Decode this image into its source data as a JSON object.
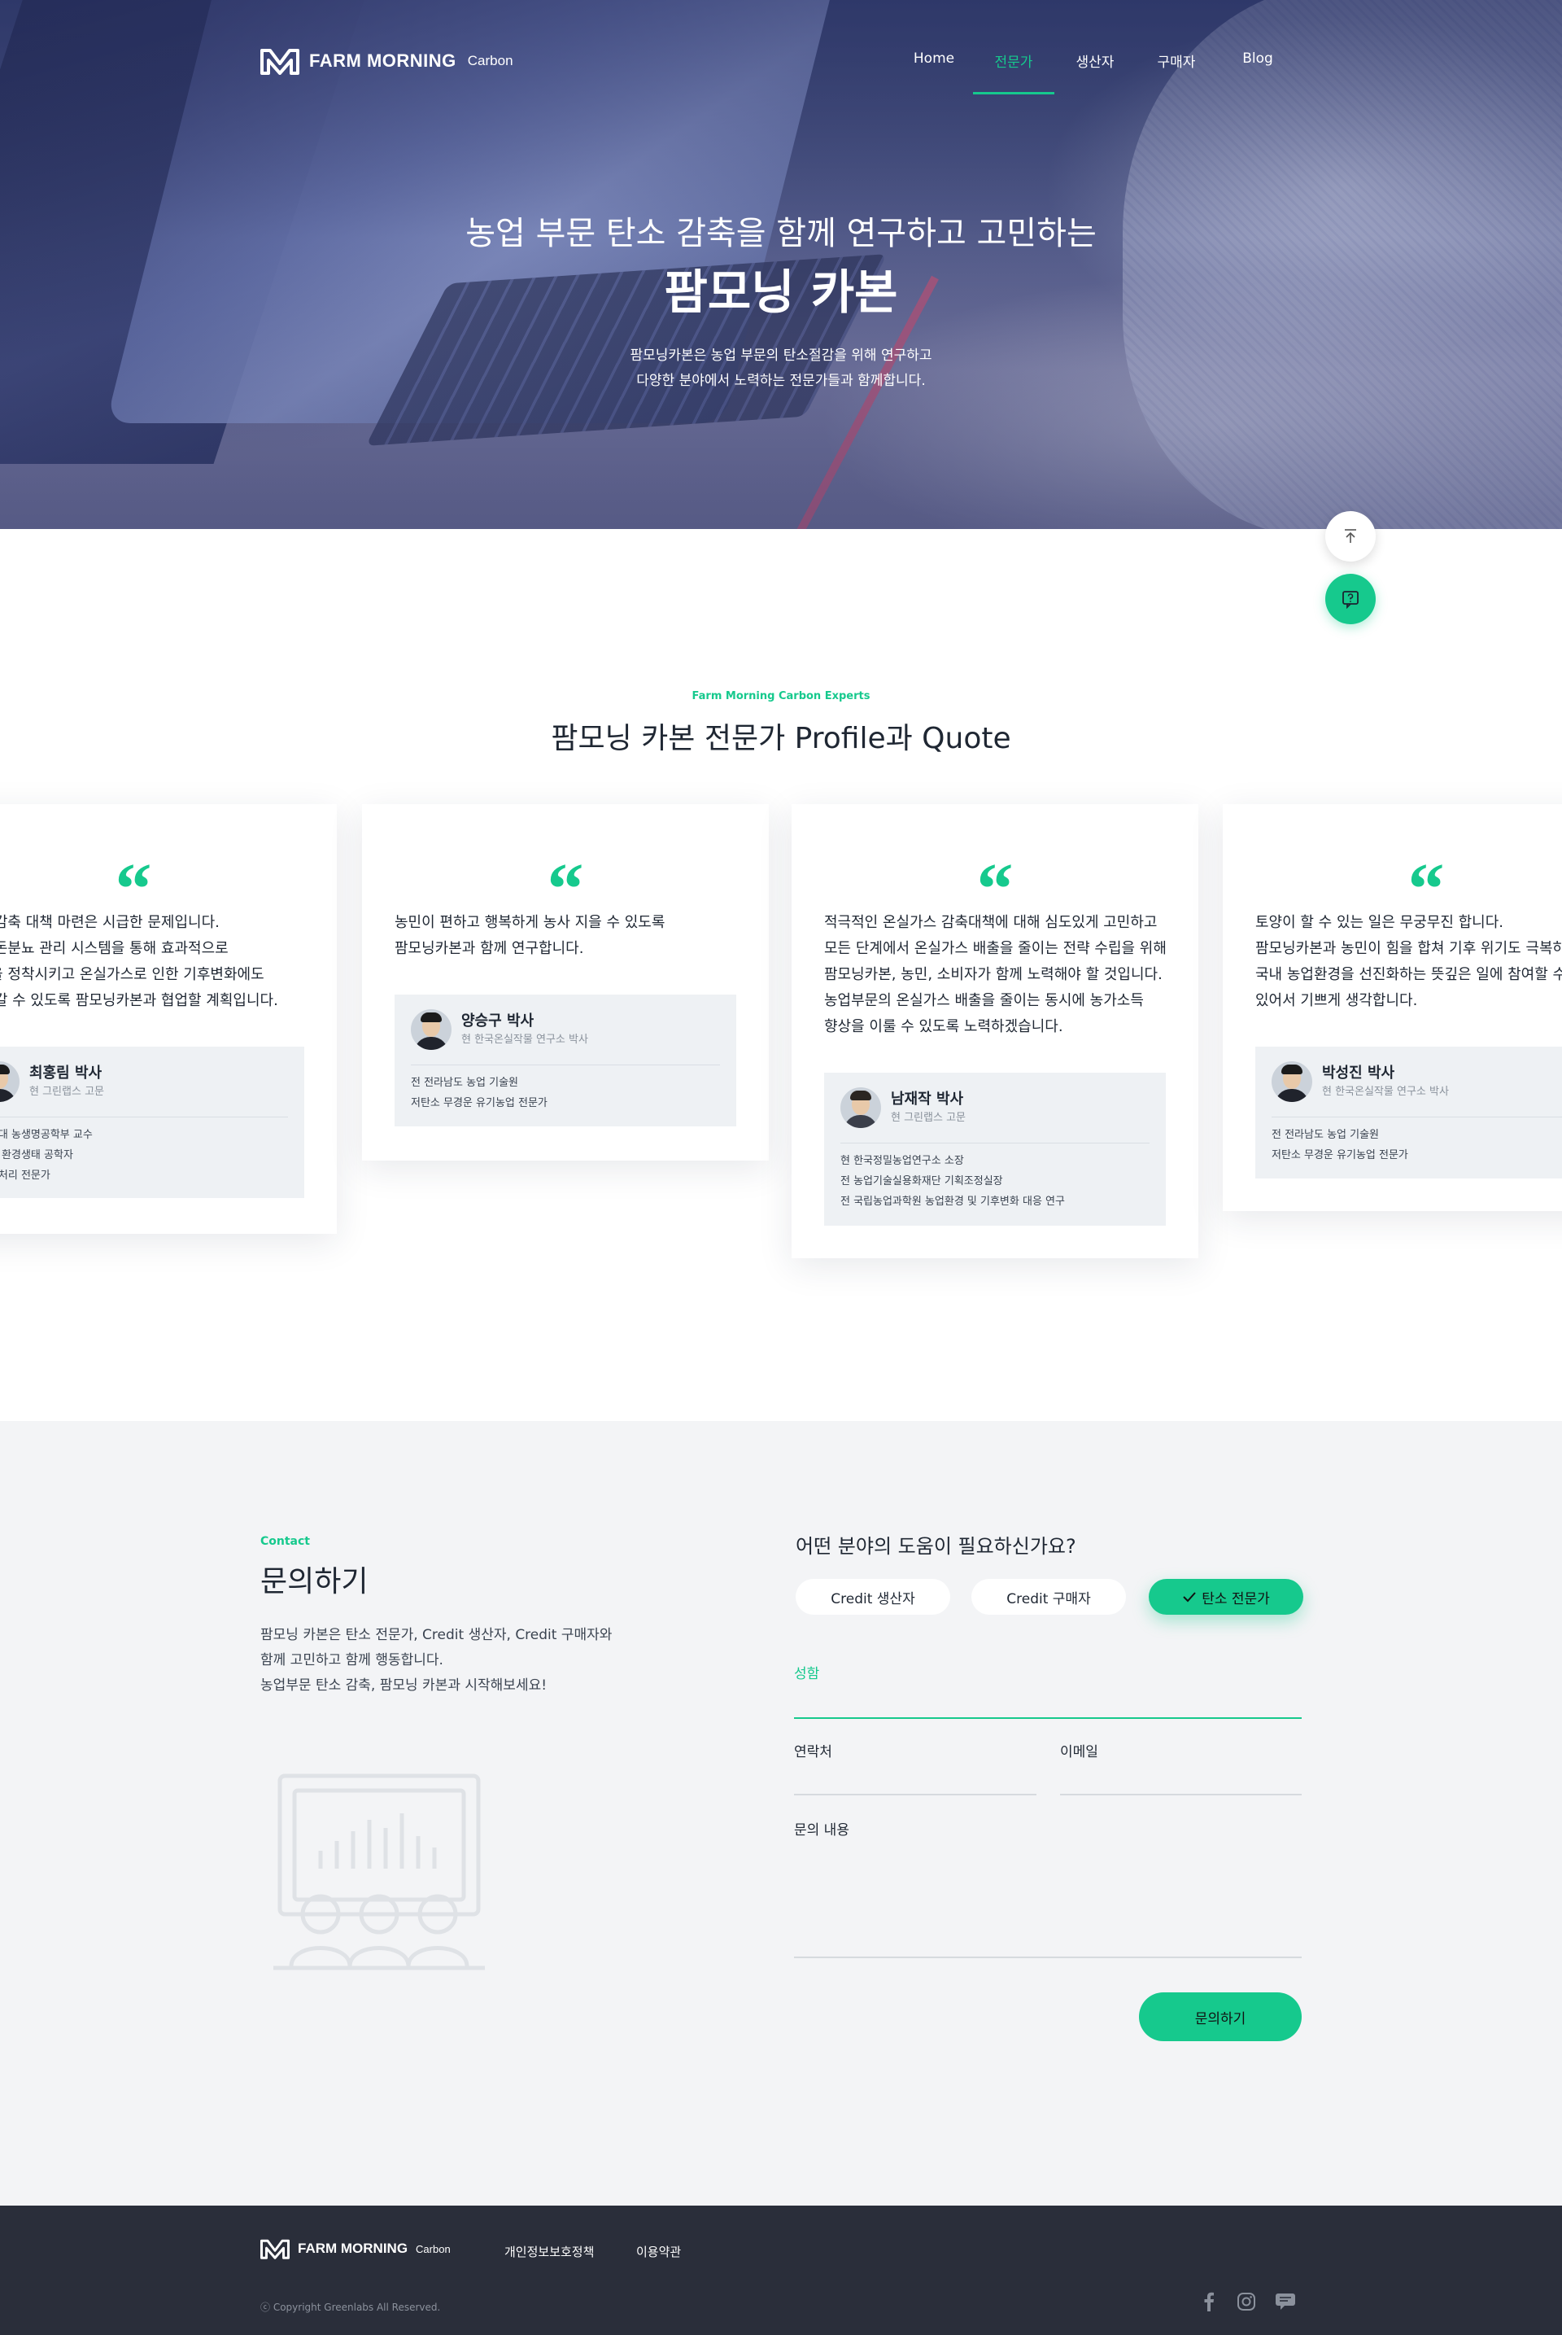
{
  "brand": {
    "name": "FARM MORNING",
    "sub": "Carbon"
  },
  "nav": {
    "items": [
      {
        "label": "Home"
      },
      {
        "label": "전문가"
      },
      {
        "label": "생산자"
      },
      {
        "label": "구매자"
      },
      {
        "label": "Blog"
      }
    ]
  },
  "hero": {
    "line1": "농업 부문 탄소 감축을 함께 연구하고 고민하는",
    "line2": "팜모닝 카본",
    "desc1": "팜모닝카본은 농업 부문의 탄소절감을 위해 연구하고",
    "desc2": "다양한 분야에서 노력하는 전문가들과 함께합니다."
  },
  "experts": {
    "label": "Farm Morning Carbon Experts",
    "title": "팜모닝 카본 전문가 Profile과 Quote",
    "cards": [
      {
        "quote": [
          "가스 감축 대책 마련은 시급한 문제입니다.",
          "화 양돈분뇨 관리 시스템을 통해 효과적으로",
          "농산을 정착시키고 온실가스로 인한 기후변화에도",
          "해 나갈 수 있도록 팜모닝카본과 협업할 계획입니다."
        ],
        "name": "최홍림 박사",
        "role": "현 그린랩스 고문",
        "history": [
          "서울대 농생명공학부 교수",
          "최초 환경생태 공학자",
          "분뇨처리 전문가"
        ]
      },
      {
        "quote": [
          "농민이 편하고 행복하게 농사 지을 수 있도록",
          "팜모닝카본과 함께 연구합니다."
        ],
        "name": "양승구 박사",
        "role": "현 한국온실작물 연구소 박사",
        "history": [
          "전 전라남도 농업 기술원",
          "저탄소 무경운 유기농업 전문가"
        ]
      },
      {
        "quote": [
          "적극적인 온실가스 감축대책에 대해 심도있게 고민하고",
          "모든 단계에서 온실가스 배출을 줄이는 전략 수립을 위해",
          "팜모닝카본, 농민, 소비자가 함께 노력해야 할 것입니다.",
          "농업부문의 온실가스 배출을 줄이는 동시에 농가소득",
          "향상을 이룰 수 있도록 노력하겠습니다."
        ],
        "name": "남재작 박사",
        "role": "현 그린랩스 고문",
        "history": [
          "현 한국정밀농업연구소 소장",
          "전 농업기술실용화재단 기획조정실장",
          "전 국립농업과학원 농업환경 및 기후변화 대응 연구"
        ]
      },
      {
        "quote": [
          "토양이 할 수 있는 일은 무궁무진 합니다.",
          "팜모닝카본과 농민이 힘을 합쳐 기후 위기도 극복하고",
          "국내 농업환경을 선진화하는 뜻깊은 일에 참여할 수",
          "있어서 기쁘게 생각합니다."
        ],
        "name": "박성진 박사",
        "role": "현 한국온실작물 연구소 박사",
        "history": [
          "전 전라남도 농업 기술원",
          "저탄소 무경운 유기농업 전문가"
        ]
      }
    ]
  },
  "contact": {
    "label": "Contact",
    "title": "문의하기",
    "desc": [
      "팜모닝 카본은 탄소 전문가, Credit 생산자, Credit 구매자와",
      "함께 고민하고 함께 행동합니다.",
      "농업부문 탄소 감축, 팜모닝 카본과 시작해보세요!"
    ],
    "question": "어떤 분야의 도움이 필요하신가요?",
    "options": [
      "Credit 생산자",
      "Credit 구매자",
      "탄소 전문가"
    ],
    "selected_option": "탄소 전문가",
    "fields": {
      "name": "성함",
      "phone": "연락처",
      "email": "이메일",
      "message": "문의 내용"
    },
    "submit": "문의하기"
  },
  "footer": {
    "links": [
      "개인정보보호정책",
      "이용약관"
    ],
    "copyright": "ⓒ Copyright Greenlabs All Reserved."
  },
  "colors": {
    "accent": "#16c98d",
    "footer_bg": "#2a2e3a",
    "contact_bg": "#f3f4f6"
  },
  "icons": {
    "scroll_top": "arrow-up-icon",
    "help": "question-chat-icon",
    "social": [
      "facebook-icon",
      "instagram-icon",
      "chat-bubble-icon"
    ]
  }
}
